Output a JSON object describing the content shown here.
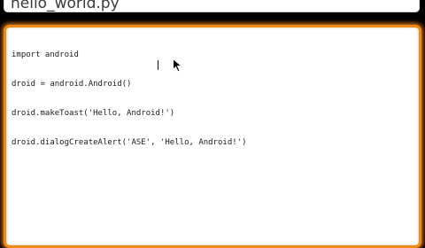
{
  "title_field": {
    "value": "hello_world.py"
  },
  "editor": {
    "lines": [
      "import android",
      "droid = android.Android()",
      "droid.makeToast('Hello, Android!')",
      "droid.dialogCreateAlert('ASE', 'Hello, Android!')"
    ]
  },
  "icons": {
    "pointer": "mouse-pointer-icon"
  },
  "colors": {
    "background": "#000000",
    "editor_border": "#f08a1c",
    "field_background": "#ffffff",
    "text": "#1a1a1a"
  }
}
